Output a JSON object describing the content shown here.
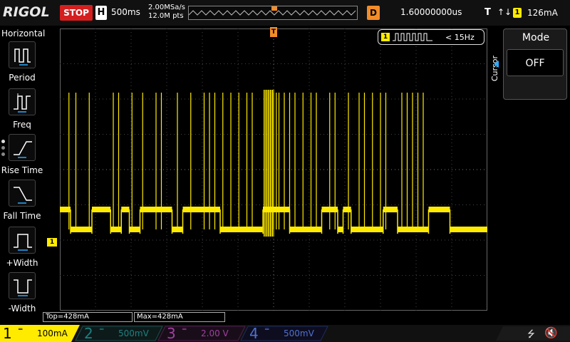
{
  "top": {
    "logo": "RIGOL",
    "run_state": "STOP",
    "timebase_badge": "H",
    "timebase": "500ms",
    "sample_rate": "2.00MSa/s",
    "memory_points": "12.0M pts",
    "delay_badge": "D",
    "delay": "1.60000000us",
    "trigger_badge": "T",
    "trigger_edge": "↑↓",
    "trigger_source": "1",
    "trigger_level": "126mA"
  },
  "left_menu": {
    "title": "Horizontal",
    "items": [
      {
        "label": "Period",
        "icon": "period-icon"
      },
      {
        "label": "Freq",
        "icon": "freq-icon"
      },
      {
        "label": "Rise Time",
        "icon": "rise-time-icon"
      },
      {
        "label": "Fall Time",
        "icon": "fall-time-icon"
      },
      {
        "label": "+Width",
        "icon": "positive-width-icon"
      },
      {
        "label": "-Width",
        "icon": "negative-width-icon"
      }
    ]
  },
  "right_panel": {
    "side_label": "Cursor",
    "mode_title": "Mode",
    "mode_value": "OFF"
  },
  "freq_readout": {
    "channel": "1",
    "text": "< 15Hz"
  },
  "markers": {
    "trigger_position": "T",
    "trigger_level": "T",
    "channel1_ground": "1"
  },
  "measurements": {
    "top": "Top=428mA",
    "max": "Max=428mA"
  },
  "channels": [
    {
      "num": "1",
      "value": "100mA",
      "color": "#ffeb00",
      "active": true
    },
    {
      "num": "2",
      "value": "500mV",
      "color": "#00a0a0",
      "active": false
    },
    {
      "num": "3",
      "value": "2.00 V",
      "color": "#c000c0",
      "active": false
    },
    {
      "num": "4",
      "value": "500mV",
      "color": "#2060ff",
      "active": false
    }
  ],
  "status_icons": [
    "usb-icon",
    "speaker-muted-icon"
  ],
  "colors": {
    "ch1": "#ffeb00",
    "trigger": "#f28c28",
    "stop": "#d51f1f",
    "grid": "#555555"
  },
  "waveform": {
    "segments": [
      [
        0,
        20,
        1
      ],
      [
        20,
        60,
        0
      ],
      [
        60,
        95,
        1
      ],
      [
        95,
        115,
        0
      ],
      [
        115,
        130,
        1
      ],
      [
        130,
        150,
        0
      ],
      [
        150,
        210,
        1
      ],
      [
        210,
        230,
        0
      ],
      [
        230,
        300,
        1
      ],
      [
        300,
        380,
        0
      ],
      [
        380,
        430,
        1
      ],
      [
        430,
        490,
        0
      ],
      [
        490,
        520,
        1
      ],
      [
        520,
        530,
        0
      ],
      [
        530,
        545,
        1
      ],
      [
        545,
        605,
        0
      ],
      [
        605,
        632,
        1
      ],
      [
        632,
        690,
        0
      ],
      [
        690,
        730,
        1
      ],
      [
        730,
        800,
        0
      ]
    ],
    "spikes": [
      17,
      30,
      55,
      100,
      110,
      135,
      155,
      180,
      190,
      220,
      245,
      270,
      280,
      290,
      305,
      320,
      335,
      350,
      360,
      400,
      405,
      410,
      420,
      430,
      440,
      455,
      470,
      480,
      505,
      515,
      540,
      560,
      570,
      585,
      600,
      610,
      640,
      650,
      660,
      670,
      680
    ],
    "burst": [
      382,
      400
    ]
  }
}
